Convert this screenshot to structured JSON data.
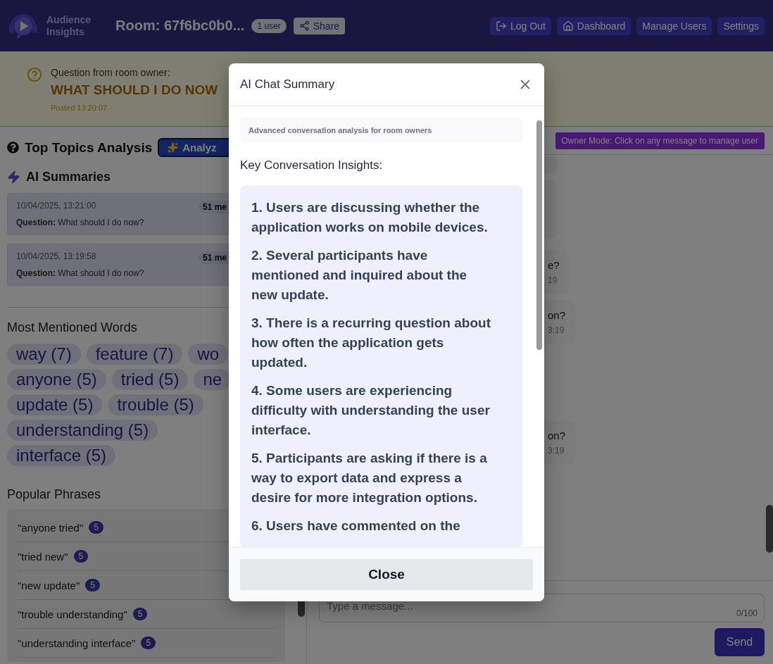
{
  "header": {
    "logo_text": "Audience Insights",
    "room_title": "Room: 67f6bc0b0...",
    "user_badge": "1 user",
    "share_button": "Share",
    "nav": [
      {
        "label": "Log Out",
        "kind": "icon"
      },
      {
        "label": "Dashboard",
        "kind": "icon"
      },
      {
        "label": "Manage Users",
        "kind": "plain"
      },
      {
        "label": "Settings",
        "kind": "plain"
      }
    ]
  },
  "question_banner": {
    "label": "Question from room owner:",
    "question": "WHAT SHOULD I DO NOW",
    "posted": "Posted 13:20:07"
  },
  "topics": {
    "title": "Top Topics Analysis",
    "analyze_button": "Analyz",
    "ai_summaries_title": "AI Summaries",
    "summaries": [
      {
        "date": "10/04/2025, 13:21:00",
        "badge": "51 me",
        "question": "**Question:** What should I do now?"
      },
      {
        "date": "10/04/2025, 13:19:58",
        "badge": "51 me",
        "question": "**Question:** What should I do now?"
      }
    ],
    "words_title": "Most Mentioned Words",
    "words": [
      "way (7)",
      "feature (7)",
      "wo",
      "anyone (5)",
      "tried (5)",
      "ne",
      "update (5)",
      "trouble (5)",
      "understanding (5)",
      "interface (5)"
    ],
    "phrases_title": "Popular Phrases",
    "phrases": [
      {
        "text": "\"anyone tried\"",
        "count": "5"
      },
      {
        "text": "\"tried new\"",
        "count": "5"
      },
      {
        "text": "\"new update\"",
        "count": "5"
      },
      {
        "text": "\"trouble understanding\"",
        "count": "5"
      },
      {
        "text": "\"understanding interface\"",
        "count": "5"
      }
    ]
  },
  "chat": {
    "owner_mode": "Owner Mode: Click on any message to manage user",
    "messages": [
      {
        "kind": "covered"
      },
      {
        "kind": "covered"
      },
      {
        "kind": "message",
        "text": "e?",
        "time": "19"
      },
      {
        "kind": "message",
        "text": "on?",
        "time": "3:19"
      },
      {
        "kind": "message",
        "text": "on?",
        "time": "3:19"
      }
    ],
    "input": {
      "placeholder": "Type a message...",
      "counter": "0/100"
    },
    "send_button": "Send"
  },
  "modal": {
    "title": "AI Chat Summary",
    "note": "Advanced conversation analysis for room owners",
    "heading": "Key Conversation Insights:",
    "insights": [
      "1. Users are discussing whether the application works on mobile devices.",
      "2. Several participants have mentioned and inquired about the new update.",
      "3. There is a recurring question about how often the application gets updated.",
      "4. Some users are experiencing difficulty with understanding the user interface.",
      "5. Participants are asking if there is a way to export data and express a desire for more integration options.",
      "6. Users have commented on the"
    ],
    "close_button": "Close"
  }
}
